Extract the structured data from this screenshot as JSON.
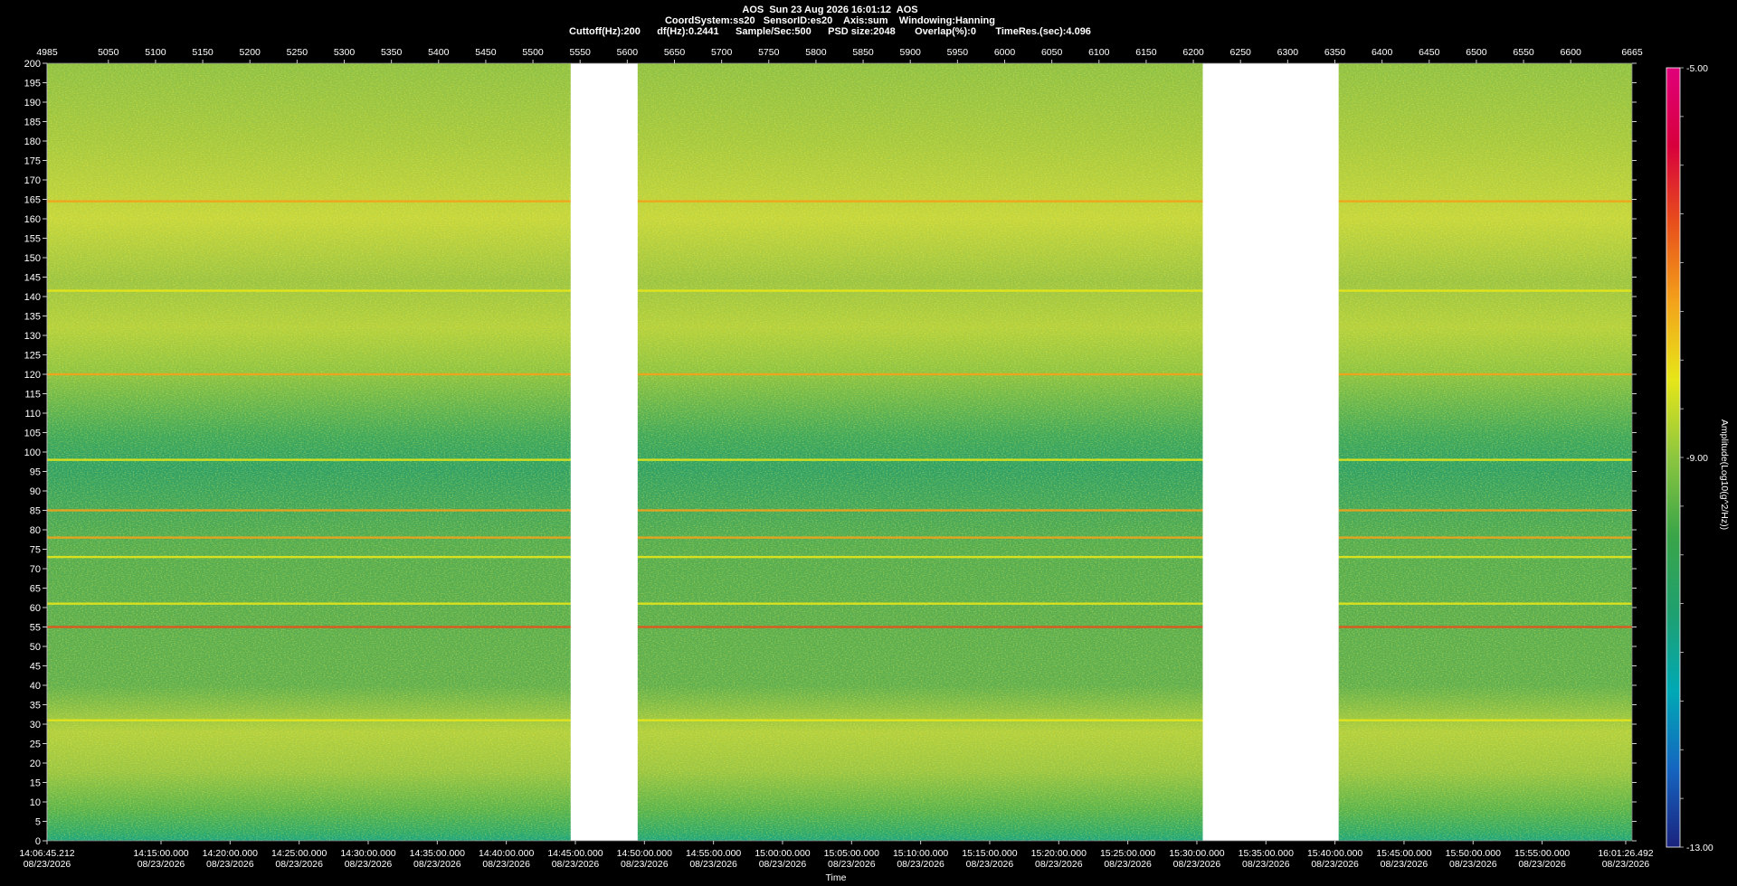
{
  "header": {
    "line1": "AOS  Sun 23 Aug 2026 16:01:12  AOS",
    "line2": "CoordSystem:ss20   SensorID:es20    Axis:sum    Windowing:Hanning",
    "line3": "Cuttoff(Hz):200      df(Hz):0.2441      Sample/Sec:500      PSD size:2048       Overlap(%):0       TimeRes.(sec):4.096"
  },
  "chart_data": {
    "type": "heatmap",
    "title": "AOS  Sun 23 Aug 2026 16:01:12  AOS",
    "xlabel": "Time",
    "ylabel": "",
    "colorbar_label": "Amplitude(Log10(g^2/Hz))",
    "colorbar_ticks": [
      "-5.00",
      "-9.00",
      "-13.00"
    ],
    "colorbar_range": [
      -13,
      -5
    ],
    "colorscale": [
      "#1a237e",
      "#1565c0",
      "#00a9b5",
      "#1fa070",
      "#3aa548",
      "#8cc63f",
      "#e6e619",
      "#f3a21a",
      "#e8501b",
      "#d7003c",
      "#e0007a"
    ],
    "ylim": [
      0,
      200
    ],
    "y_ticks": [
      0,
      5,
      10,
      15,
      20,
      25,
      30,
      35,
      40,
      45,
      50,
      55,
      60,
      65,
      70,
      75,
      80,
      85,
      90,
      95,
      100,
      105,
      110,
      115,
      120,
      125,
      130,
      135,
      140,
      145,
      150,
      155,
      160,
      165,
      170,
      175,
      180,
      185,
      190,
      195,
      200
    ],
    "top_axis_range": [
      4985,
      6665
    ],
    "top_ticks": [
      5050,
      5100,
      5150,
      5200,
      5250,
      5300,
      5350,
      5400,
      5450,
      5500,
      5550,
      5600,
      5650,
      5700,
      5750,
      5800,
      5850,
      5900,
      5950,
      6000,
      6050,
      6100,
      6150,
      6200,
      6250,
      6300,
      6350,
      6400,
      6450,
      6500,
      6550,
      6600
    ],
    "top_first_label": "4985",
    "top_last_label": "6665",
    "x_ticks": [
      {
        "t": "14:06:45.212",
        "d": "08/23/2026",
        "edge": "left"
      },
      {
        "t": "14:15:00.000",
        "d": "08/23/2026"
      },
      {
        "t": "14:20:00.000",
        "d": "08/23/2026"
      },
      {
        "t": "14:25:00.000",
        "d": "08/23/2026"
      },
      {
        "t": "14:30:00.000",
        "d": "08/23/2026"
      },
      {
        "t": "14:35:00.000",
        "d": "08/23/2026"
      },
      {
        "t": "14:40:00.000",
        "d": "08/23/2026"
      },
      {
        "t": "14:45:00.000",
        "d": "08/23/2026"
      },
      {
        "t": "14:50:00.000",
        "d": "08/23/2026"
      },
      {
        "t": "14:55:00.000",
        "d": "08/23/2026"
      },
      {
        "t": "15:00:00.000",
        "d": "08/23/2026"
      },
      {
        "t": "15:05:00.000",
        "d": "08/23/2026"
      },
      {
        "t": "15:10:00.000",
        "d": "08/23/2026"
      },
      {
        "t": "15:15:00.000",
        "d": "08/23/2026"
      },
      {
        "t": "15:20:00.000",
        "d": "08/23/2026"
      },
      {
        "t": "15:25:00.000",
        "d": "08/23/2026"
      },
      {
        "t": "15:30:00.000",
        "d": "08/23/2026"
      },
      {
        "t": "15:35:00.000",
        "d": "08/23/2026"
      },
      {
        "t": "15:40:00.000",
        "d": "08/23/2026"
      },
      {
        "t": "15:45:00.000",
        "d": "08/23/2026"
      },
      {
        "t": "15:50:00.000",
        "d": "08/23/2026"
      },
      {
        "t": "15:55:00.000",
        "d": "08/23/2026"
      },
      {
        "t": "16:01:26.492",
        "d": "08/23/2026",
        "edge": "right"
      }
    ],
    "data_gaps_seconds": [
      [
        5540,
        5611
      ],
      [
        6210,
        6354
      ]
    ],
    "tonal_lines_hz": [
      {
        "hz": 164.5,
        "level": -8.0
      },
      {
        "hz": 141.5,
        "level": -8.6
      },
      {
        "hz": 120.0,
        "level": -8.0
      },
      {
        "hz": 98.0,
        "level": -8.8
      },
      {
        "hz": 85.0,
        "level": -8.2
      },
      {
        "hz": 78.0,
        "level": -8.0
      },
      {
        "hz": 73.0,
        "level": -8.4
      },
      {
        "hz": 61.0,
        "level": -8.6
      },
      {
        "hz": 55.0,
        "level": -7.4
      },
      {
        "hz": 31.0,
        "level": -8.7
      }
    ]
  }
}
